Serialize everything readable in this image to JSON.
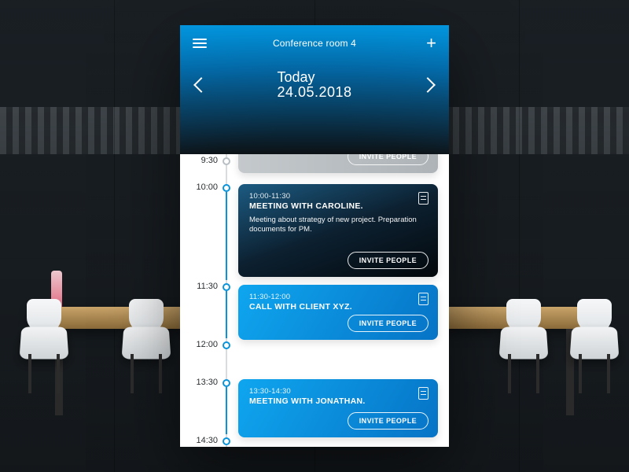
{
  "header": {
    "room_title": "Conference room 4",
    "date_label": "Today",
    "date_value": "24.05.2018"
  },
  "buttons": {
    "invite": "INVITE PEOPLE"
  },
  "timeline": {
    "ticks": [
      "9:30",
      "10:00",
      "11:30",
      "12:00",
      "13:30",
      "14:30"
    ]
  },
  "events": [
    {
      "time": "",
      "title": "",
      "desc": ""
    },
    {
      "time": "10:00-11:30",
      "title": "MEETING WITH CAROLINE.",
      "desc": "Meeting about strategy of new project. Preparation documents for PM."
    },
    {
      "time": "11:30-12:00",
      "title": "CALL WITH CLIENT XYZ.",
      "desc": ""
    },
    {
      "time": "13:30-14:30",
      "title": "MEETING WITH JONATHAN.",
      "desc": ""
    }
  ]
}
